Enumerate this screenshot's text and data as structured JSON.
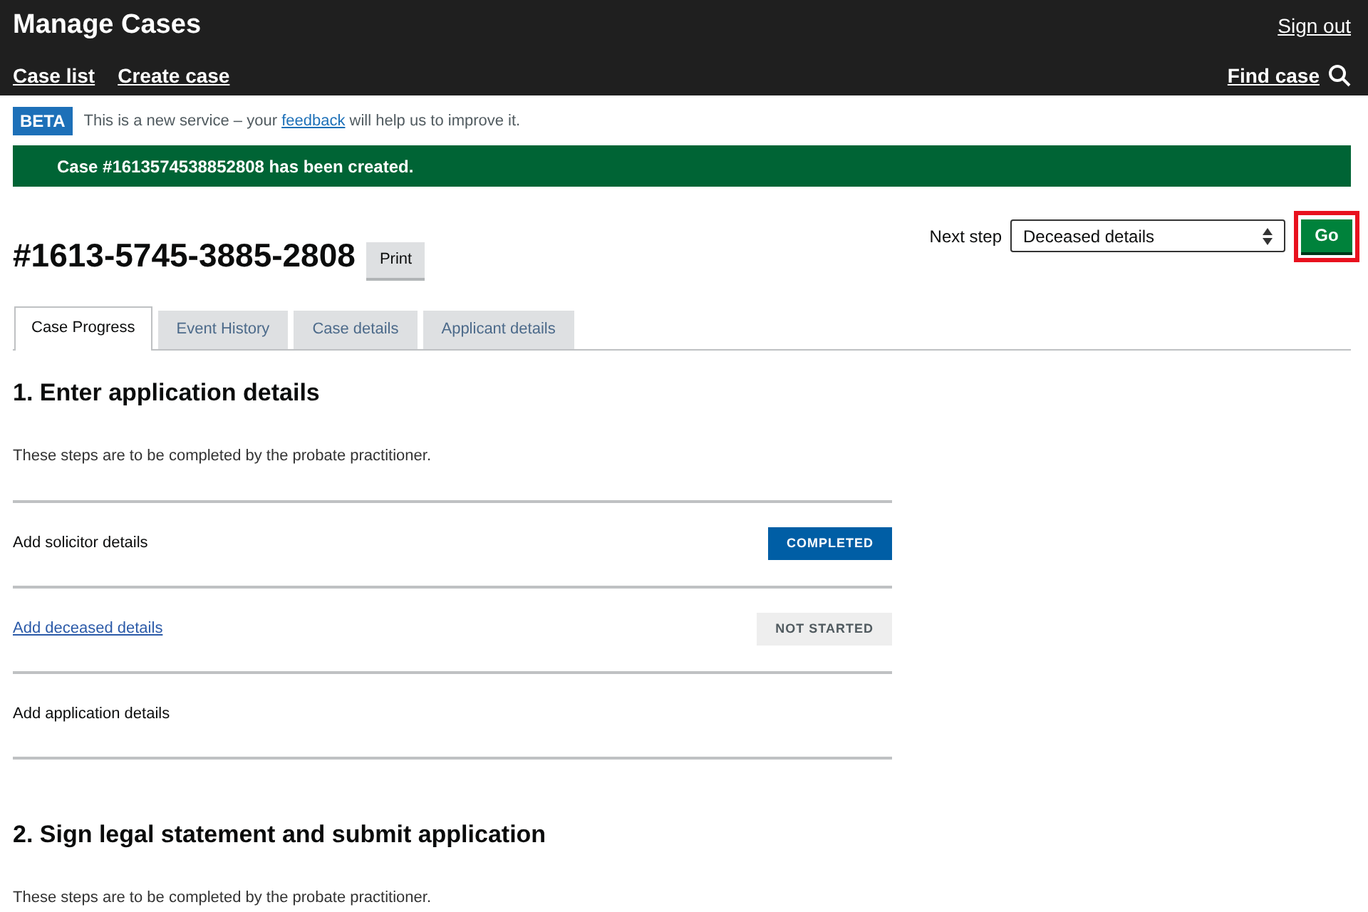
{
  "header": {
    "title": "Manage Cases",
    "sign_out": "Sign out",
    "nav": [
      "Case list",
      "Create case"
    ],
    "find_case": "Find case"
  },
  "phase_banner": {
    "tag": "BETA",
    "text_before": "This is a new service – your",
    "link": "feedback",
    "text_after": "will help us to improve it."
  },
  "notification": "Case #1613574538852808 has been created.",
  "case": {
    "number": "#1613-5745-3885-2808",
    "print": "Print"
  },
  "next_step": {
    "label": "Next step",
    "value": "Deceased details",
    "go": "Go",
    "highlighted": true
  },
  "tabs": [
    {
      "label": "Case Progress",
      "selected": true
    },
    {
      "label": "Event History",
      "selected": false
    },
    {
      "label": "Case details",
      "selected": false
    },
    {
      "label": "Applicant details",
      "selected": false
    }
  ],
  "sections": [
    {
      "title": "1. Enter application details",
      "note": "These steps are to be completed by the probate practitioner.",
      "steps": [
        {
          "label": "Add solicitor details",
          "link": false,
          "status": {
            "kind": "completed",
            "text": "COMPLETED"
          }
        },
        {
          "label": "Add deceased details",
          "link": true,
          "status": {
            "kind": "not_started",
            "text": "NOT STARTED"
          }
        },
        {
          "label": "Add application details",
          "link": false
        }
      ]
    },
    {
      "title": "2. Sign legal statement and submit application",
      "note": "These steps are to be completed by the probate practitioner."
    }
  ]
}
